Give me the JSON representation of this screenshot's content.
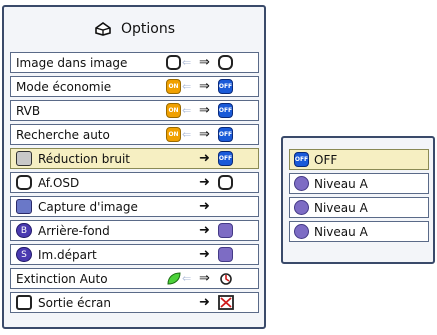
{
  "menu": {
    "title": "Options",
    "items": [
      {
        "label": "Image dans image"
      },
      {
        "label": "Mode économie"
      },
      {
        "label": "RVB"
      },
      {
        "label": "Recherche auto"
      },
      {
        "label": "Réduction bruit"
      },
      {
        "label": "Af.OSD"
      },
      {
        "label": "Capture d'image"
      },
      {
        "label": "Arrière-fond"
      },
      {
        "label": "Im.départ"
      },
      {
        "label": "Extinction Auto"
      },
      {
        "label": "Sortie écran"
      }
    ]
  },
  "icons": {
    "on": "ON",
    "off": "OFF",
    "b": "B",
    "s": "S"
  },
  "submenu": {
    "items": [
      {
        "label": "OFF"
      },
      {
        "label": "Niveau A"
      },
      {
        "label": "Niveau A"
      },
      {
        "label": "Niveau A"
      }
    ]
  },
  "colors": {
    "selected_row": "#f6efc2",
    "border": "#3a4a6a",
    "on_icon": "#f0a000",
    "off_icon": "#1a5ad8"
  }
}
